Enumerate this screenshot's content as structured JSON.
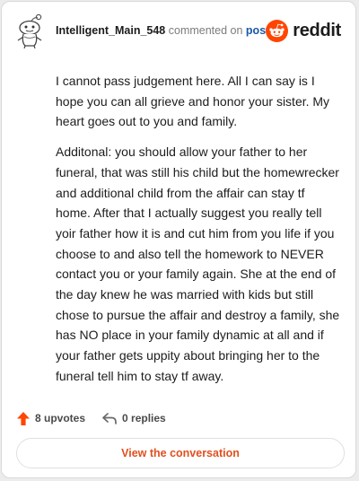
{
  "header": {
    "username": "Intelligent_Main_548",
    "commented_on": "commented on",
    "post_link": "post",
    "brand_name": "reddit",
    "brand_color": "#FF4500"
  },
  "comment": {
    "paragraphs": [
      "I cannot pass judgement here. All I can say is I hope you can all grieve and honor your sister. My heart goes out to you and family.",
      "Additonal: you should allow your father to her funeral, that was still his child but the homewrecker and additional child from the affair can stay tf home. After that I actually suggest you really tell yoir father how it is and cut him from you life if you choose to and also tell the homework to NEVER contact you or your family again. She at the end of the day knew he was married with kids but still chose to pursue the affair and destroy a family, she has NO place in your family dynamic at all and if your father gets uppity about bringing her to the funeral tell him to stay tf away."
    ]
  },
  "actions": {
    "upvotes": "8 upvotes",
    "replies": "0 replies",
    "upvote_icon": "upvote-arrow-icon",
    "reply_icon": "reply-arrow-icon",
    "upvote_color": "#FF4500"
  },
  "footer": {
    "view_label": "View the conversation",
    "view_color": "#E0501F"
  }
}
